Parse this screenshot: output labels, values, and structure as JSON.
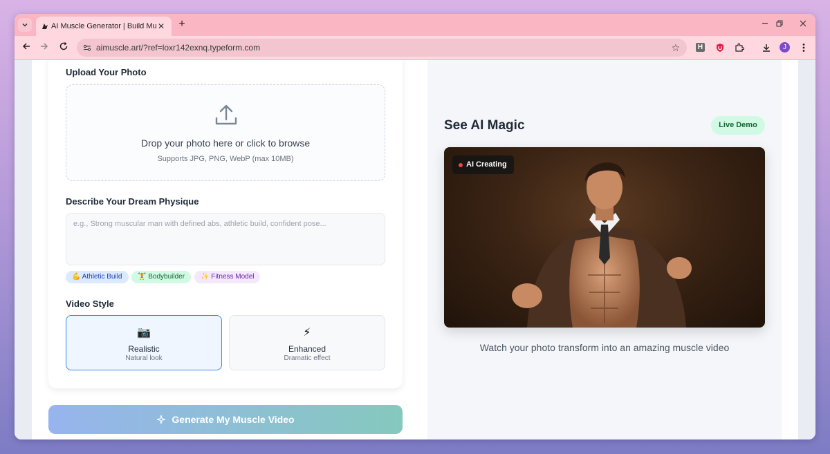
{
  "browser": {
    "tab_title": "AI Muscle Generator | Build Mu",
    "url": "aimuscle.art/?ref=loxr142exnq.typeform.com",
    "profile_initial": "J",
    "ext_h_label": "H"
  },
  "form": {
    "upload_label": "Upload Your Photo",
    "dropzone_main": "Drop your photo here or click to browse",
    "dropzone_sub": "Supports JPG, PNG, WebP (max 10MB)",
    "describe_label": "Describe Your Dream Physique",
    "describe_placeholder": "e.g., Strong muscular man with defined abs, athletic build, confident pose...",
    "chips": [
      {
        "label": "💪 Athletic Build",
        "bg": "#dbeafe",
        "color": "#1e40af"
      },
      {
        "label": "🏋 Bodybuilder",
        "bg": "#d1fae5",
        "color": "#166534"
      },
      {
        "label": "✨ Fitness Model",
        "bg": "#f3e8ff",
        "color": "#6b21a8"
      }
    ],
    "video_style_label": "Video Style",
    "styles": [
      {
        "icon": "📷",
        "name": "Realistic",
        "desc": "Natural look",
        "selected": true
      },
      {
        "icon": "⚡",
        "name": "Enhanced",
        "desc": "Dramatic effect",
        "selected": false
      }
    ],
    "generate_label": "Generate My Muscle Video"
  },
  "demo": {
    "title": "See AI Magic",
    "badge": "Live Demo",
    "image_badge": "AI Creating",
    "caption": "Watch your photo transform into an amazing muscle video"
  },
  "colors": {
    "tabstrip": "#fbb6c3",
    "toolbar": "#ffd7df",
    "accent_blue": "#3b82f6",
    "live_green": "#d1fae5"
  }
}
